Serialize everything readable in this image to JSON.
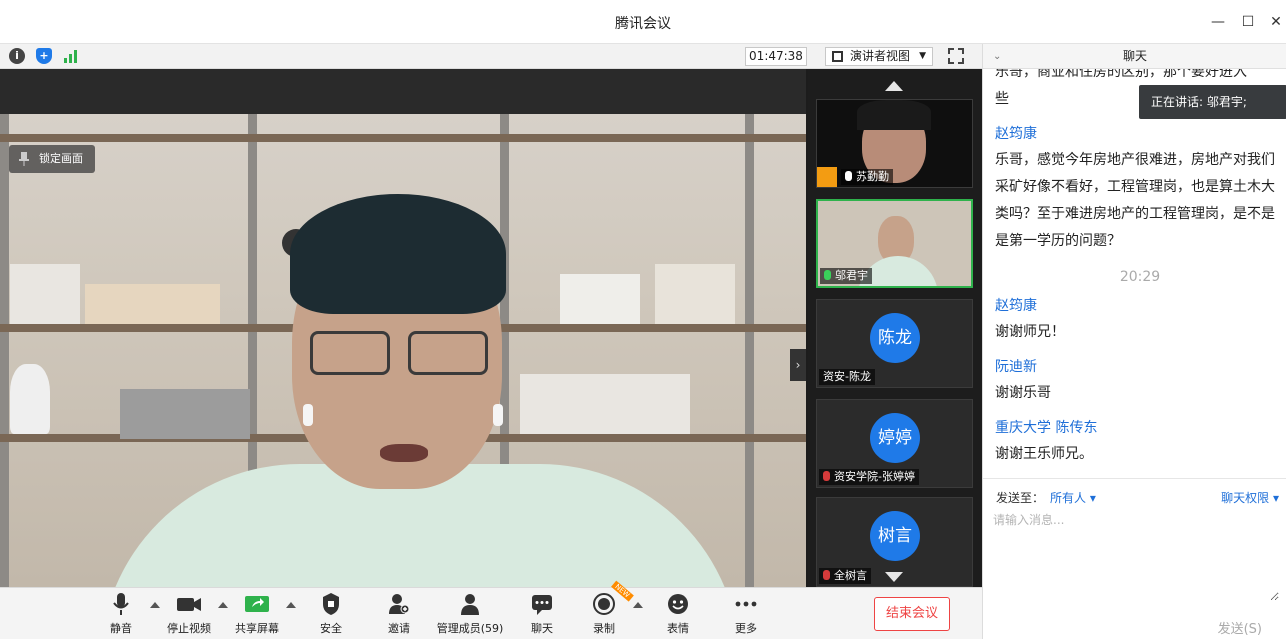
{
  "window": {
    "title": "腾讯会议"
  },
  "topbar": {
    "timer": "01:47:38",
    "view_mode": "演讲者视图"
  },
  "main_video": {
    "lock_label": "锁定画面"
  },
  "thumbnails": [
    {
      "name": "苏勤勤",
      "type": "video"
    },
    {
      "name": "邬君宇",
      "type": "video",
      "active": true
    },
    {
      "name": "资安-陈龙",
      "avatar": "陈龙"
    },
    {
      "name": "资安学院-张婷婷",
      "avatar": "婷婷"
    },
    {
      "name": "全树言",
      "avatar": "树言"
    }
  ],
  "chat": {
    "header": "聊天",
    "speaking": "正在讲话: 邬君宇;",
    "partial": "乐哥，商业和住房的区别，那个要好进入",
    "partial2": "些",
    "messages": [
      {
        "sender": "赵筠康",
        "text": "乐哥，感觉今年房地产很难进，房地产对我们采矿好像不看好，工程管理岗，也是算土木大类吗？至于难进房地产的工程管理岗，是不是是第一学历的问题？"
      }
    ],
    "time": "20:29",
    "messages2": [
      {
        "sender": "赵筠康",
        "text": "谢谢师兄！"
      },
      {
        "sender": "阮迪新",
        "text": "谢谢乐哥"
      },
      {
        "sender": "重庆大学 陈传东",
        "text": "谢谢王乐师兄。"
      }
    ],
    "send_to_label": "发送至：",
    "send_to_value": "所有人",
    "permission": "聊天权限",
    "placeholder": "请输入消息...",
    "send_button": "发送(S)"
  },
  "toolbar": {
    "mute": "静音",
    "stop_video": "停止视频",
    "share": "共享屏幕",
    "security": "安全",
    "invite": "邀请",
    "members": "管理成员(59)",
    "chat": "聊天",
    "record": "录制",
    "reaction": "表情",
    "more": "更多",
    "end": "结束会议",
    "new_tag": "NEW"
  },
  "colors": {
    "accent": "#1f7ae8",
    "active_border": "#2fb24c",
    "end": "#e44444",
    "link": "#1f6fd8"
  }
}
